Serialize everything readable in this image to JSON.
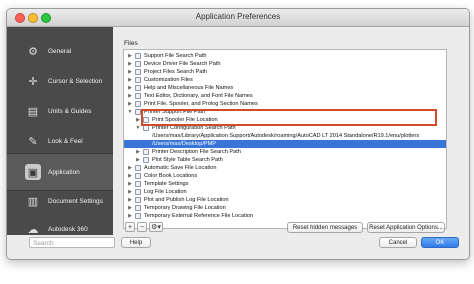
{
  "window": {
    "title": "Application Preferences"
  },
  "sidebar": {
    "items": [
      {
        "label": "General",
        "icon": "gear-icon"
      },
      {
        "label": "Cursor & Selection",
        "icon": "cursor-icon"
      },
      {
        "label": "Units & Guides",
        "icon": "ruler-icon"
      },
      {
        "label": "Look & Feel",
        "icon": "brush-icon"
      },
      {
        "label": "Application",
        "icon": "application-icon",
        "active": true
      },
      {
        "label": "Document Settings",
        "icon": "document-icon"
      },
      {
        "label": "Autodesk 360",
        "icon": "cloud-icon"
      }
    ],
    "search_placeholder": "Search"
  },
  "files_panel": {
    "label": "Files",
    "items": [
      {
        "label": "Support File Search Path",
        "expanded": false
      },
      {
        "label": "Device Driver File Search Path",
        "expanded": false
      },
      {
        "label": "Project Files Search Path",
        "expanded": false
      },
      {
        "label": "Customization Files",
        "expanded": false
      },
      {
        "label": "Help and Miscellaneous File Names",
        "expanded": false
      },
      {
        "label": "Text Editor, Dictionary, and Font File Names",
        "expanded": false
      },
      {
        "label": "Print File, Spooler, and Prolog Section Names",
        "expanded": false
      },
      {
        "label": "Printer Support File Path",
        "expanded": true
      },
      {
        "label": "Print Spooler File Location",
        "expanded": false
      },
      {
        "label": "Printer Configuration Search Path",
        "expanded": true
      },
      {
        "label": "/Users/max/Library/Application Support/Autodesk/roaming/AutoCAD LT 2014 Standalone/R19.1/enu/plotters"
      },
      {
        "label": "/Users/max/Desktop/PMP"
      },
      {
        "label": "Printer Description File Search Path",
        "expanded": false
      },
      {
        "label": "Plot Style Table Search Path",
        "expanded": false
      },
      {
        "label": "Automatic Save File Location",
        "expanded": false
      },
      {
        "label": "Color Book Locations",
        "expanded": false
      },
      {
        "label": "Template Settings",
        "expanded": false
      },
      {
        "label": "Log File Location",
        "expanded": false
      },
      {
        "label": "Plot and Publish Log File Location",
        "expanded": false
      },
      {
        "label": "Temporary Drawing File Location",
        "expanded": false
      },
      {
        "label": "Temporary External Reference File Location",
        "expanded": false
      }
    ]
  },
  "toolbar": {
    "add": "+",
    "remove": "−",
    "options": "⚙▾"
  },
  "buttons": {
    "reset_hidden": "Reset hidden messages",
    "reset_app_options": "Reset Application Options...",
    "help": "Help",
    "cancel": "Cancel",
    "ok": "OK"
  },
  "colors": {
    "selection": "#3875d7",
    "highlight_box": "#d24a2a",
    "sidebar_bg": "#4a4a4a"
  }
}
